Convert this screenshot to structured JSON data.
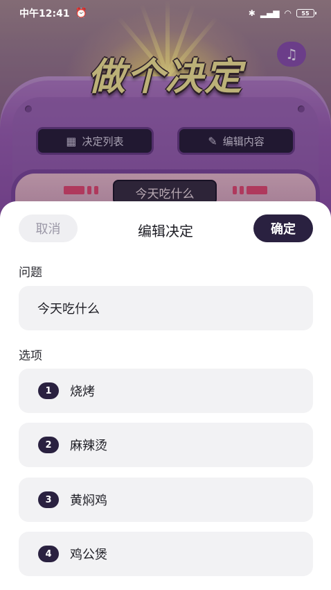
{
  "status_bar": {
    "time": "中午12:41",
    "battery": "55"
  },
  "game": {
    "title": "做个决定",
    "music_icon": "music-note-icon",
    "decision_list_label": "决定列表",
    "edit_content_label": "编辑内容",
    "current_question": "今天吃什么"
  },
  "sheet": {
    "cancel_label": "取消",
    "title": "编辑决定",
    "confirm_label": "确定",
    "question_label": "问题",
    "question_value": "今天吃什么",
    "options_label": "选项",
    "options": [
      {
        "num": "1",
        "text": "烧烤"
      },
      {
        "num": "2",
        "text": "麻辣烫"
      },
      {
        "num": "3",
        "text": "黄焖鸡"
      },
      {
        "num": "4",
        "text": "鸡公煲"
      }
    ]
  },
  "colors": {
    "accent_dark": "#2a2140",
    "sheet_bg": "#ffffff",
    "field_bg": "#f2f2f4"
  }
}
